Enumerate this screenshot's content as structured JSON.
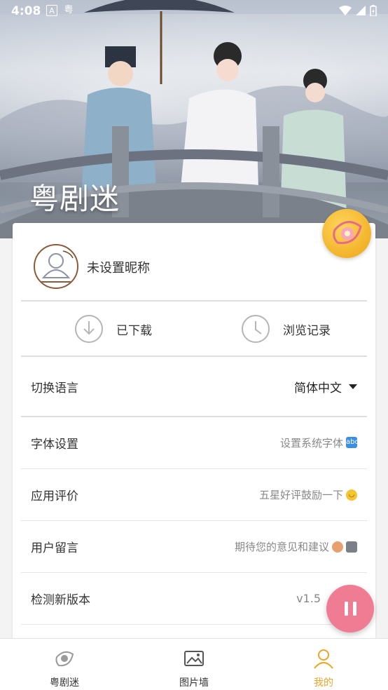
{
  "status_bar": {
    "time": "4:08",
    "icons": [
      "a-letter-icon",
      "yue-char-icon"
    ],
    "yue_char": "粤"
  },
  "hero": {
    "title": "粤剧迷"
  },
  "profile": {
    "nickname": "未设置昵称"
  },
  "quick_actions": [
    {
      "label": "已下载",
      "icon": "download-icon"
    },
    {
      "label": "浏览记录",
      "icon": "clock-icon"
    }
  ],
  "settings": {
    "language": {
      "title": "切换语言",
      "value": "简体中文"
    },
    "font": {
      "title": "字体设置",
      "value": "设置系统字体",
      "emoji": "🔤"
    },
    "rate": {
      "title": "应用评价",
      "value": "五星好评鼓励一下",
      "emoji": "😊"
    },
    "feedback": {
      "title": "用户留言",
      "value": "期待您的意见和建议",
      "emoji": "👦💻"
    },
    "update": {
      "title": "检测新版本",
      "value": "v1.5"
    }
  },
  "bottom_nav": [
    {
      "label": "粤剧迷",
      "icon": "opera-logo-icon",
      "active": false
    },
    {
      "label": "图片墙",
      "icon": "image-icon",
      "active": false
    },
    {
      "label": "我的",
      "icon": "profile-icon",
      "active": true
    }
  ],
  "colors": {
    "accent": "#e8a628",
    "fab": "#f07c94",
    "float_logo": "#f2b32a"
  }
}
